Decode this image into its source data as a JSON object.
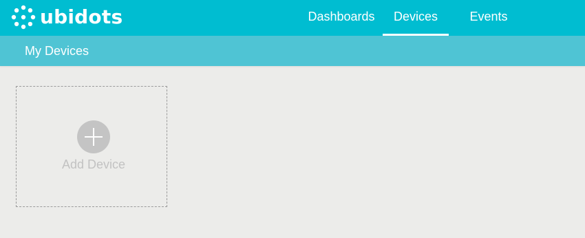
{
  "header": {
    "logo_text": "ubidots",
    "logo_icon": "ubidots-dots-logo-icon",
    "nav": [
      {
        "label": "Dashboards",
        "active": false
      },
      {
        "label": "Devices",
        "active": true
      },
      {
        "label": "Events",
        "active": false
      }
    ]
  },
  "subheader": {
    "title": "My Devices"
  },
  "main": {
    "add_device_label": "Add Device",
    "add_icon": "plus-circle-icon"
  },
  "colors": {
    "topbar": "#00bdd1",
    "subbar": "#4fc4d4",
    "background": "#ececea",
    "add_icon_fill": "#c4c4c4",
    "add_label": "#c2c2c2"
  }
}
